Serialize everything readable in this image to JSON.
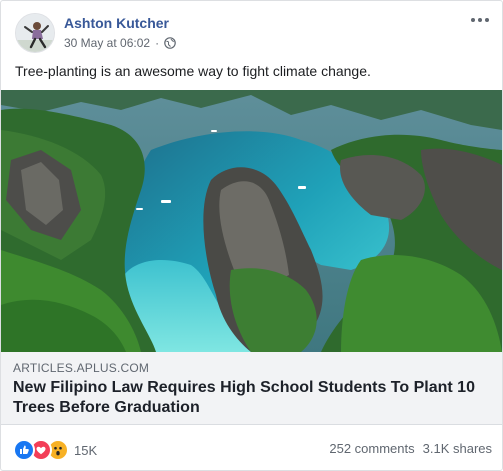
{
  "post": {
    "author": "Ashton Kutcher",
    "timestamp": "30 May at 06:02",
    "privacy_icon": "globe-icon",
    "more_icon": "ellipsis-icon",
    "text": "Tree-planting is an awesome way to fight climate change."
  },
  "link_preview": {
    "domain": "ARTICLES.APLUS.COM",
    "title": "New Filipino Law Requires High School Students To Plant 10 Trees Before Graduation"
  },
  "footer": {
    "reactions": [
      "like-icon",
      "love-icon",
      "wow-icon"
    ],
    "reaction_count": "15K",
    "comments": "252 comments",
    "shares": "3.1K shares"
  },
  "colors": {
    "author_link": "#385898",
    "like": "#1877f2",
    "love": "#f33e58",
    "wow": "#f7b125"
  }
}
